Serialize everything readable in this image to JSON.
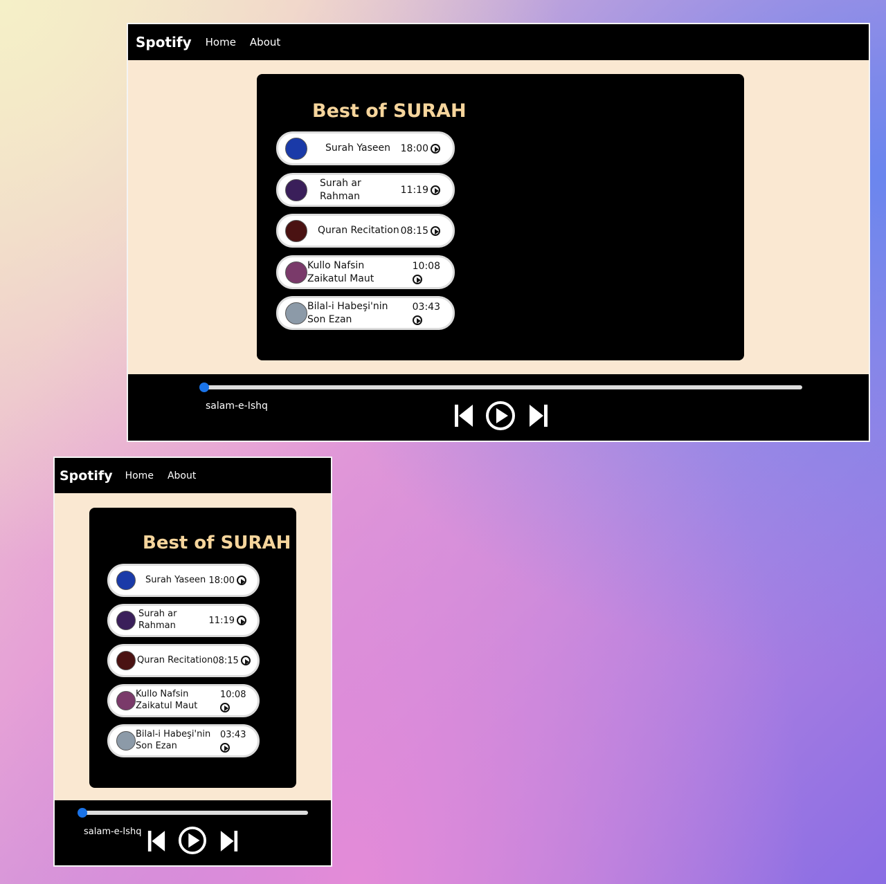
{
  "nav": {
    "brand": "Spotify",
    "links": [
      "Home",
      "About"
    ]
  },
  "card": {
    "title": "Best of SURAH"
  },
  "songs": [
    {
      "name": "Surah Yaseen",
      "time": "18:00",
      "thumb_color": "#1a3aa8"
    },
    {
      "name": "Surah ar Rahman",
      "time": "11:19",
      "thumb_color": "#3a1f5a"
    },
    {
      "name": "Quran Recitation",
      "time": "08:15",
      "thumb_color": "#4a1212"
    },
    {
      "name": "Kullo Nafsin Zaikatul Maut",
      "time": "10:08",
      "thumb_color": "#7a3a6a"
    },
    {
      "name": "Bilal-i Habeşi'nin Son Ezan",
      "time": "03:43",
      "thumb_color": "#8c9aa8"
    }
  ],
  "player": {
    "now_playing": "salam-e-Ishq",
    "progress": 0
  },
  "colors": {
    "accent": "#1a73e8",
    "title": "#f6d59c",
    "page_bg": "#fae8d2"
  }
}
